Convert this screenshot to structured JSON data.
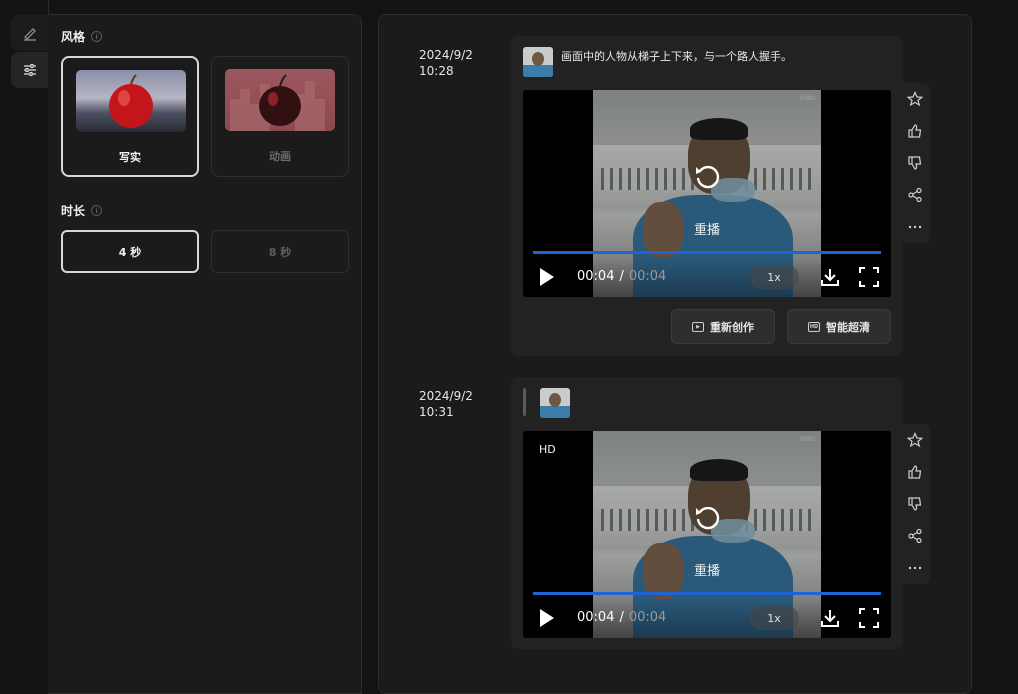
{
  "rail": {
    "icons": [
      "brush-icon",
      "sliders-icon"
    ]
  },
  "settings": {
    "style_title": "风格",
    "style_options": [
      {
        "label": "写实",
        "selected": true
      },
      {
        "label": "动画",
        "selected": false
      }
    ],
    "duration_title": "时长",
    "duration_options": [
      {
        "label": "4 秒",
        "selected": true
      },
      {
        "label": "8 秒",
        "selected": false
      }
    ]
  },
  "feed": {
    "entries": [
      {
        "date": "2024/9/2",
        "time": "10:28",
        "prompt": "画面中的人物从梯子上下来，与一个路人握手。",
        "video": {
          "watermark": "Vidu",
          "badge": "",
          "replay_label": "重播",
          "current_time": "00:04",
          "separator": "/",
          "total_time": "00:04",
          "rate": "1x",
          "progress": 1.0
        },
        "actions": [
          {
            "label": "重新创作",
            "icon": "recreate-icon"
          },
          {
            "label": "智能超清",
            "icon": "hd-icon"
          }
        ]
      },
      {
        "date": "2024/9/2",
        "time": "10:31",
        "prompt": "",
        "video": {
          "watermark": "Vidu",
          "badge": "HD",
          "replay_label": "重播",
          "current_time": "00:04",
          "separator": "/",
          "total_time": "00:04",
          "rate": "1x",
          "progress": 1.0
        }
      }
    ],
    "side_tools": [
      "star-icon",
      "thumbs-up-icon",
      "thumbs-down-icon",
      "share-icon",
      "more-icon"
    ]
  },
  "colors": {
    "accent": "#1f64d6",
    "background": "#131313",
    "panel": "#1b1b1b"
  }
}
